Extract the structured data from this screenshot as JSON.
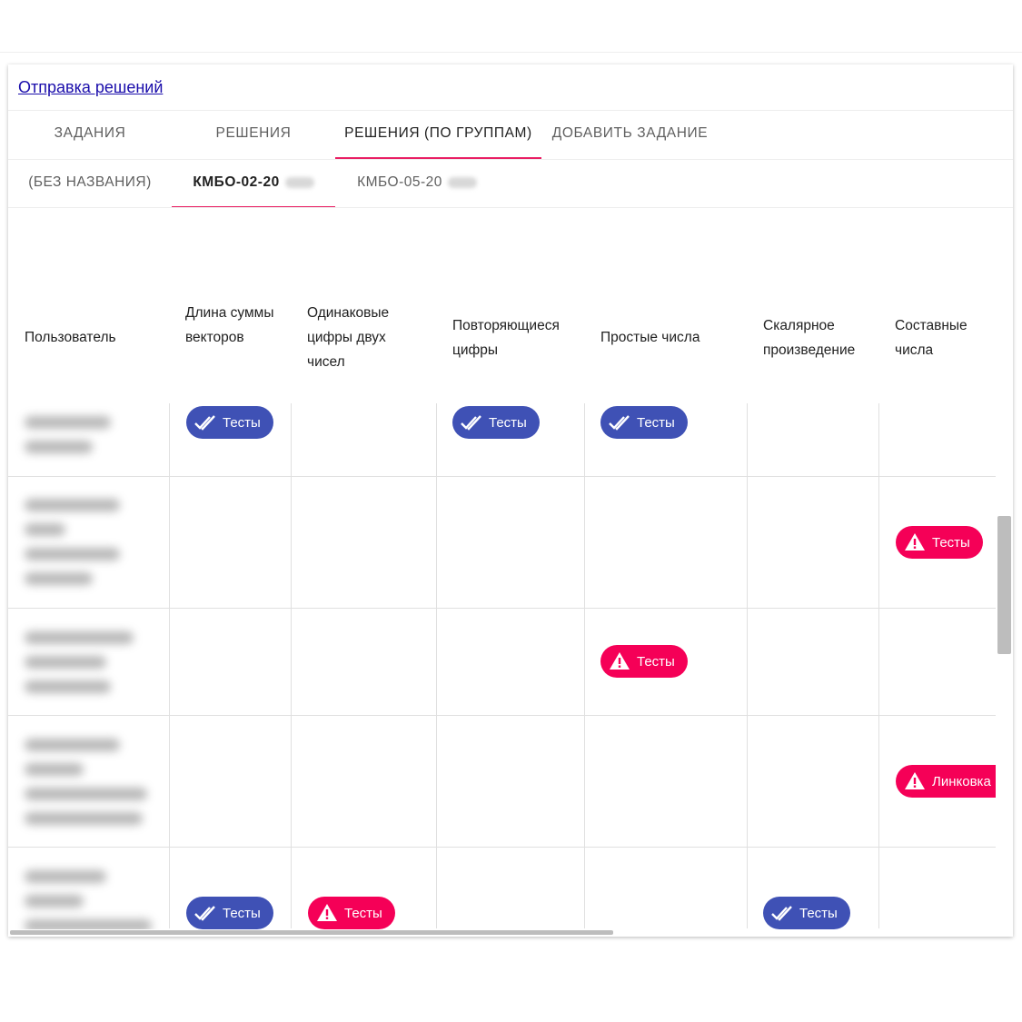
{
  "page": {
    "link": "Отправка решений"
  },
  "tabs": [
    {
      "label": "Задания"
    },
    {
      "label": "Решения"
    },
    {
      "label": "Решения (по группам)"
    },
    {
      "label": "Добавить задание"
    }
  ],
  "group_tabs": [
    {
      "label": "(БЕЗ НАЗВАНИЯ)"
    },
    {
      "label": "КМБО-02-20"
    },
    {
      "label": "КМБО-05-20"
    }
  ],
  "table": {
    "headers": {
      "user": "Пользователь",
      "c1": "Длина суммы векторов",
      "c2": "Одинаковые цифры двух чисел",
      "c3": "Повторяющиеся цифры",
      "c4": "Простые числа",
      "c5": "Скалярное произведение",
      "c6": "Составные числа"
    },
    "chips": [
      {
        "label": "Тесты",
        "status": "passed",
        "icon": "double-check-icon"
      },
      {
        "label": "Тесты",
        "status": "passed",
        "icon": "double-check-icon"
      },
      {
        "label": "Тесты",
        "status": "passed",
        "icon": "double-check-icon"
      },
      {
        "label": "Тесты",
        "status": "failed",
        "icon": "warning-icon"
      },
      {
        "label": "Тесты",
        "status": "failed",
        "icon": "warning-icon"
      },
      {
        "label": "Линковка",
        "status": "failed",
        "icon": "warning-icon"
      },
      {
        "label": "Тесты",
        "status": "passed",
        "icon": "double-check-icon"
      },
      {
        "label": "Тесты",
        "status": "failed",
        "icon": "warning-icon"
      },
      {
        "label": "Тесты",
        "status": "passed",
        "icon": "double-check-icon"
      }
    ]
  },
  "colors": {
    "accent": "#e91e63",
    "passed": "#3f51b5",
    "failed": "#f50057",
    "link": "#1a0dab"
  }
}
